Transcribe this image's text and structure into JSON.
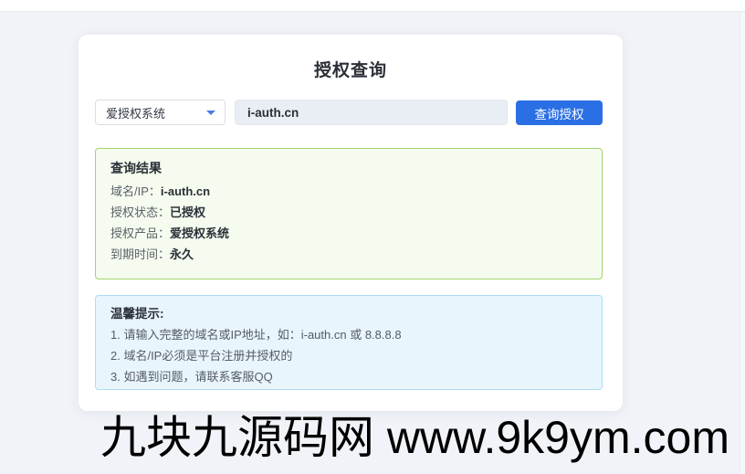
{
  "card": {
    "title": "授权查询",
    "form": {
      "select": {
        "value": "爱授权系统",
        "caret_icon": "chevron-down-icon",
        "caret_color": "#4a7de0"
      },
      "input": {
        "value": "i-auth.cn"
      },
      "button": {
        "label": "查询授权",
        "color": "#2b6fe5"
      }
    },
    "result": {
      "title": "查询结果",
      "rows": [
        {
          "label": "域名/IP：",
          "value": "i-auth.cn"
        },
        {
          "label": "授权状态：",
          "value": "已授权"
        },
        {
          "label": "授权产品：",
          "value": "爱授权系统"
        },
        {
          "label": "到期时间：",
          "value": "永久"
        }
      ],
      "background": "#f5fbef",
      "border_color": "#a3d469"
    },
    "tips": {
      "title": "温馨提示:",
      "items": [
        "1. 请输入完整的域名或IP地址，如：i-auth.cn 或 8.8.8.8",
        "2. 域名/IP必须是平台注册并授权的",
        "3. 如遇到问题，请联系客服QQ"
      ],
      "background": "#e8f5fd",
      "border_color": "#aedcf4"
    }
  },
  "watermark": {
    "text": "九块九源码网 www.9k9ym.com"
  },
  "colors": {
    "page_background": "#f1f3f8",
    "card_background": "#ffffff",
    "accent_blue": "#2b6fe5"
  }
}
